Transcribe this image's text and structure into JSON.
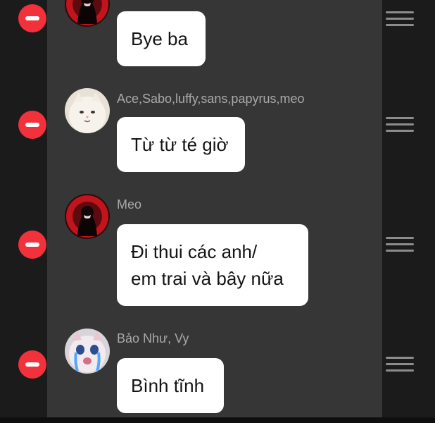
{
  "colors": {
    "panel": "#363636",
    "side": "#1b1b1b",
    "remove": "#f2313b",
    "bubble": "#ffffff",
    "sender_text": "#a9a9a9",
    "handle": "#8c8c8c"
  },
  "messages": [
    {
      "sender": "",
      "avatar": "dark-red-avatar-icon",
      "text_lines": [
        "Bye ba"
      ]
    },
    {
      "sender": "Ace,Sabo,luffy,sans,papyrus,meo",
      "avatar": "white-cat-avatar-icon",
      "text_lines": [
        "Từ từ té giờ"
      ]
    },
    {
      "sender": "Meo",
      "avatar": "dark-red-avatar-icon",
      "text_lines": [
        "Đi thui các anh/",
        "em trai và bây nữa"
      ]
    },
    {
      "sender": "Bảo Như, Vy",
      "avatar": "crying-cat-avatar-icon",
      "text_lines": [
        "Bình tĩnh"
      ]
    }
  ]
}
